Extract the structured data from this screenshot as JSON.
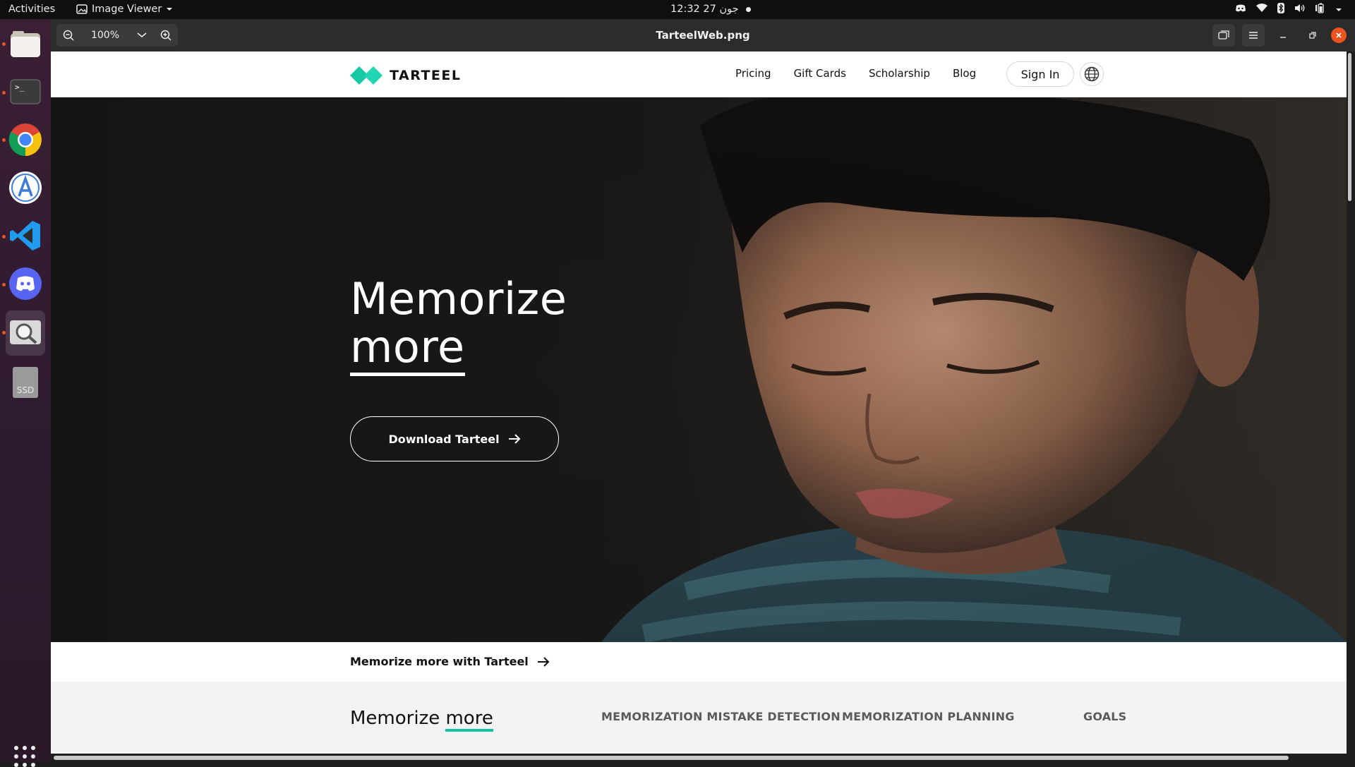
{
  "system_bar": {
    "activities": "Activities",
    "app_name": "Image Viewer",
    "clock": "12:32  27 جون"
  },
  "viewer": {
    "zoom": "100%",
    "title": "TarteelWeb.png"
  },
  "dock": {
    "items": [
      "Files",
      "Terminal",
      "Google Chrome",
      "App Center",
      "Visual Studio Code",
      "Discord",
      "Image Viewer",
      "SSD"
    ],
    "ssd_label": "SSD"
  },
  "site": {
    "brand": "TARTEEL",
    "nav": [
      "Pricing",
      "Gift Cards",
      "Scholarship",
      "Blog"
    ],
    "sign_in": "Sign In",
    "hero": {
      "line1": "Memorize",
      "line2": "more",
      "cta": "Download Tarteel"
    },
    "strip_link": "Memorize more with Tarteel",
    "section": {
      "title_plain": "Memorize ",
      "title_highlight": "more",
      "tabs": [
        "MEMORIZATION MISTAKE DETECTION",
        "MEMORIZATION PLANNING",
        "GOALS"
      ]
    },
    "colors": {
      "brand_teal": "#0fc2a1",
      "hero_bg": "#141414"
    }
  }
}
